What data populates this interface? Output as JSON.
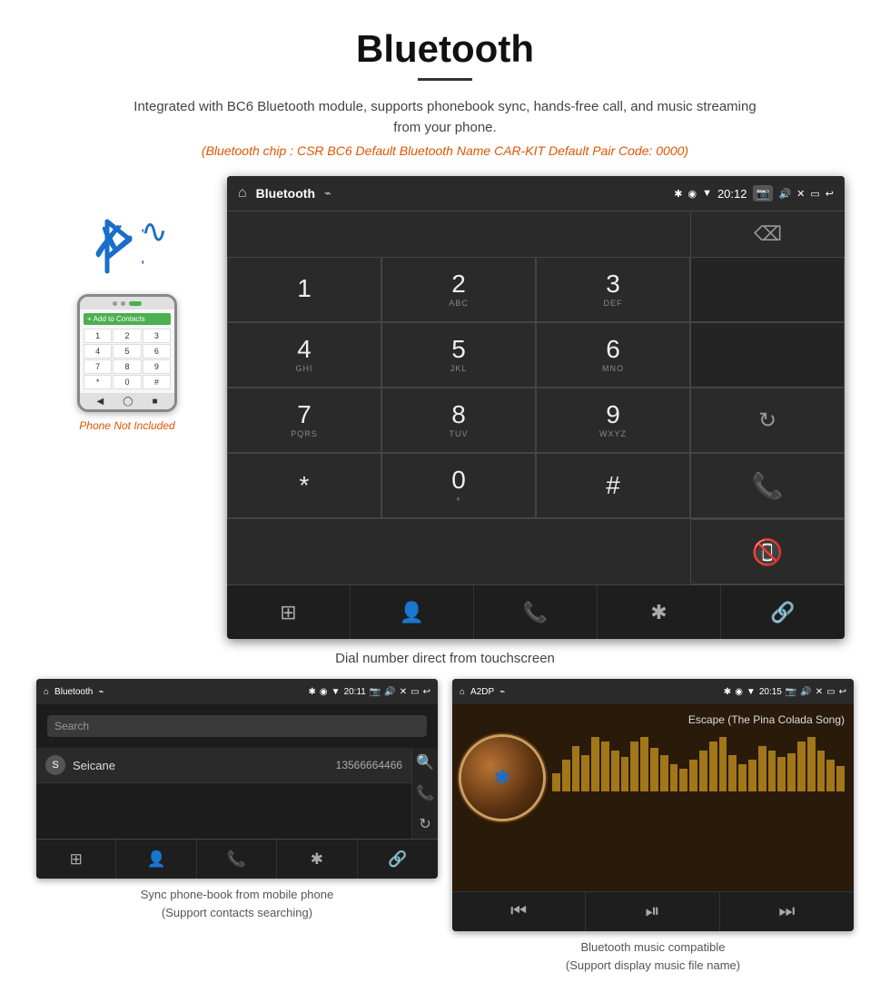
{
  "page": {
    "title": "Bluetooth",
    "subtitle": "Integrated with BC6 Bluetooth module, supports phonebook sync, hands-free call, and music streaming from your phone.",
    "specs": "(Bluetooth chip : CSR BC6    Default Bluetooth Name CAR-KIT    Default Pair Code: 0000)"
  },
  "main_screen": {
    "status_bar": {
      "label": "Bluetooth",
      "time": "20:12",
      "usb_icon": "⌁",
      "home_icon": "⌂"
    },
    "dialer": {
      "keys": [
        {
          "main": "1",
          "sub": ""
        },
        {
          "main": "2",
          "sub": "ABC"
        },
        {
          "main": "3",
          "sub": "DEF"
        },
        {
          "main": "",
          "sub": ""
        },
        {
          "main": "4",
          "sub": "GHI"
        },
        {
          "main": "5",
          "sub": "JKL"
        },
        {
          "main": "6",
          "sub": "MNO"
        },
        {
          "main": "",
          "sub": ""
        },
        {
          "main": "7",
          "sub": "PQRS"
        },
        {
          "main": "8",
          "sub": "TUV"
        },
        {
          "main": "9",
          "sub": "WXYZ"
        },
        {
          "main": "",
          "sub": "reload"
        },
        {
          "main": "*",
          "sub": ""
        },
        {
          "main": "0",
          "sub": "+"
        },
        {
          "main": "#",
          "sub": ""
        },
        {
          "main": "",
          "sub": "call"
        },
        {
          "main": "",
          "sub": "hangup"
        }
      ]
    },
    "nav": [
      "⊞",
      "👤",
      "📞",
      "✱",
      "🔗"
    ]
  },
  "phone_left": {
    "not_included": "Phone Not Included"
  },
  "main_caption": "Dial number direct from touchscreen",
  "bottom_left": {
    "title": "Sync phone-book from mobile phone",
    "subtitle": "(Support contacts searching)",
    "status_label": "Bluetooth",
    "time": "20:11",
    "search_placeholder": "Search",
    "contact_letter": "S",
    "contact_name": "Seicane",
    "contact_phone": "13566664466"
  },
  "bottom_right": {
    "title": "Bluetooth music compatible",
    "subtitle": "(Support display music file name)",
    "status_label": "A2DP",
    "time": "20:15",
    "song_title": "Escape (The Pina Colada Song)",
    "viz_heights": [
      20,
      35,
      50,
      40,
      60,
      55,
      45,
      38,
      55,
      60,
      48,
      40,
      30,
      25,
      35,
      45,
      55,
      60,
      40,
      30,
      35,
      50,
      45,
      38,
      42,
      55,
      60,
      45,
      35,
      28
    ]
  }
}
